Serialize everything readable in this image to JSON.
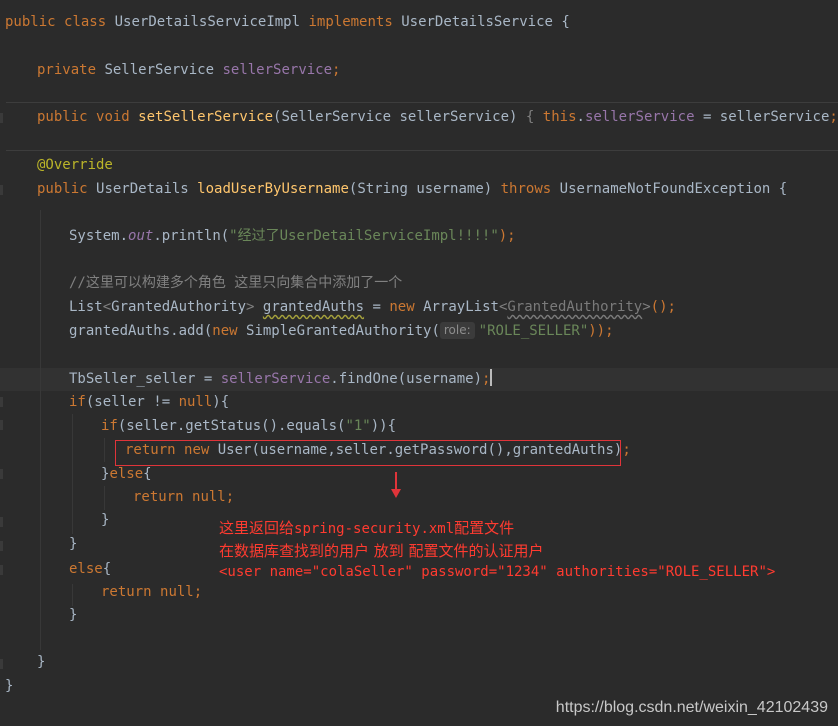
{
  "code": {
    "class_decl": {
      "public": "public",
      "class": "class",
      "name": "UserDetailsServiceImpl",
      "implements": "implements",
      "iface": "UserDetailsService",
      "brace": " {"
    },
    "field_decl": {
      "private": "private",
      "type": "SellerService",
      "name": "sellerService",
      "semi": ";"
    },
    "setter": {
      "public": "public",
      "void": "void",
      "name": "setSellerService",
      "params": "(SellerService sellerService)",
      "open": "{",
      "this": "this",
      "dot": ".",
      "field": "sellerService",
      "assign": " = sellerService",
      "semi": ";",
      "close": "}"
    },
    "annotation": "@Override",
    "method": {
      "public": "public",
      "ret": "UserDetails",
      "name": "loadUserByUsername",
      "params": "(String username)",
      "throws": "throws",
      "exception": "UsernameNotFoundException",
      "brace": " {"
    },
    "println": {
      "system": "System.",
      "out": "out",
      "call": ".println(",
      "arg": "\"经过了UserDetailServiceImpl!!!!\"",
      "end": ");"
    },
    "comment": "//这里可以构建多个角色 这里只向集合中添加了一个",
    "list_decl": {
      "type": "List",
      "lt": "<",
      "generic": "GrantedAuthority",
      "gt": ">",
      "var": "grantedAuths",
      "eq": " = ",
      "new": "new",
      "impl": "ArrayList",
      "lt2": "<",
      "generic2": "GrantedAuthority",
      "gt2": ">",
      "end": "();"
    },
    "add_call": {
      "pre": "grantedAuths.add(",
      "new": "new",
      "cls": " SimpleGrantedAuthority(",
      "hint": "role:",
      "arg": "\"ROLE_SELLER\"",
      "end": "));"
    },
    "find": {
      "decl": "TbSeller_seller = ",
      "svc": "sellerService",
      "call": ".findOne(username)",
      "semi": ";"
    },
    "if1": {
      "if": "if",
      "cond": "(seller != ",
      "null": "null",
      "end": "){"
    },
    "if2": {
      "if": "if",
      "pre": "(seller.getStatus().equals(",
      "arg": "\"1\"",
      "end": ")){"
    },
    "ret1": {
      "return": "return",
      "new": "new",
      "body": " User(username,seller.getPassword(),grantedAuths)",
      "semi": ";"
    },
    "else1": {
      "close": "}",
      "else": "else",
      "open": "{"
    },
    "ret2": {
      "return": "return",
      "null": "null",
      "semi": ";"
    },
    "close_b": "}",
    "else2": {
      "else": "else",
      "open": "{"
    }
  },
  "annotation_note": {
    "line1_cn": "这里返回给",
    "line1_code": "spring-security.xml",
    "line1_cn2": "配置文件",
    "line2": "在数据库查找到的用户 放到 配置文件的认证用户",
    "line3": "<user name=\"colaSeller\" password=\"1234\" authorities=\"ROLE_SELLER\">"
  },
  "watermark": "https://blog.csdn.net/weixin_42102439",
  "colors": {
    "background": "#2b2b2b",
    "keyword": "#cc7832",
    "method": "#ffc66d",
    "field": "#9876aa",
    "string": "#6a8759",
    "comment": "#808080",
    "annotation": "#bbb529",
    "highlight": "#e0343a"
  }
}
